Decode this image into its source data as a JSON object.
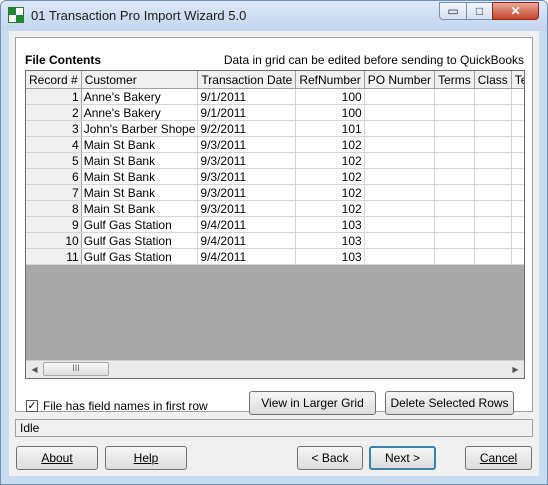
{
  "window": {
    "title": "01 Transaction Pro Import Wizard 5.0",
    "min_glyph": "▭",
    "max_glyph": "□",
    "close_glyph": "✕"
  },
  "panel": {
    "heading": "File Contents",
    "note": "Data in grid can be edited before sending to QuickBooks"
  },
  "grid": {
    "columns": [
      "Record #",
      "Customer",
      "Transaction Date",
      "RefNumber",
      "PO Number",
      "Terms",
      "Class",
      "Tem"
    ],
    "rows": [
      {
        "record": "1",
        "customer": "Anne's Bakery",
        "date": "9/1/2011",
        "ref": "100"
      },
      {
        "record": "2",
        "customer": "Anne's Bakery",
        "date": "9/1/2011",
        "ref": "100"
      },
      {
        "record": "3",
        "customer": "John's Barber Shope",
        "date": "9/2/2011",
        "ref": "101"
      },
      {
        "record": "4",
        "customer": "Main St Bank",
        "date": "9/3/2011",
        "ref": "102"
      },
      {
        "record": "5",
        "customer": "Main St Bank",
        "date": "9/3/2011",
        "ref": "102"
      },
      {
        "record": "6",
        "customer": "Main St Bank",
        "date": "9/3/2011",
        "ref": "102"
      },
      {
        "record": "7",
        "customer": "Main St Bank",
        "date": "9/3/2011",
        "ref": "102"
      },
      {
        "record": "8",
        "customer": "Main St Bank",
        "date": "9/3/2011",
        "ref": "102"
      },
      {
        "record": "9",
        "customer": "Gulf Gas Station",
        "date": "9/4/2011",
        "ref": "103"
      },
      {
        "record": "10",
        "customer": "Gulf Gas Station",
        "date": "9/4/2011",
        "ref": "103"
      },
      {
        "record": "11",
        "customer": "Gulf Gas Station",
        "date": "9/4/2011",
        "ref": "103"
      }
    ],
    "scroll_left_glyph": "◀",
    "scroll_right_glyph": "▶",
    "thumb_glyph": "III"
  },
  "options": {
    "field_names_label": "File has field names in first row",
    "field_names_checked": true,
    "check_glyph": "✓"
  },
  "buttons": {
    "view_larger": "View in Larger Grid",
    "delete_rows": "Delete Selected Rows",
    "about": "About",
    "help": "Help",
    "back": "< Back",
    "next": "Next >",
    "cancel": "Cancel"
  },
  "status": "Idle",
  "colors": {
    "title_bar": "#c9dbef",
    "close_button": "#c8432b",
    "grid_empty": "#a9a9a9",
    "default_button_border": "#3c7fb1"
  }
}
